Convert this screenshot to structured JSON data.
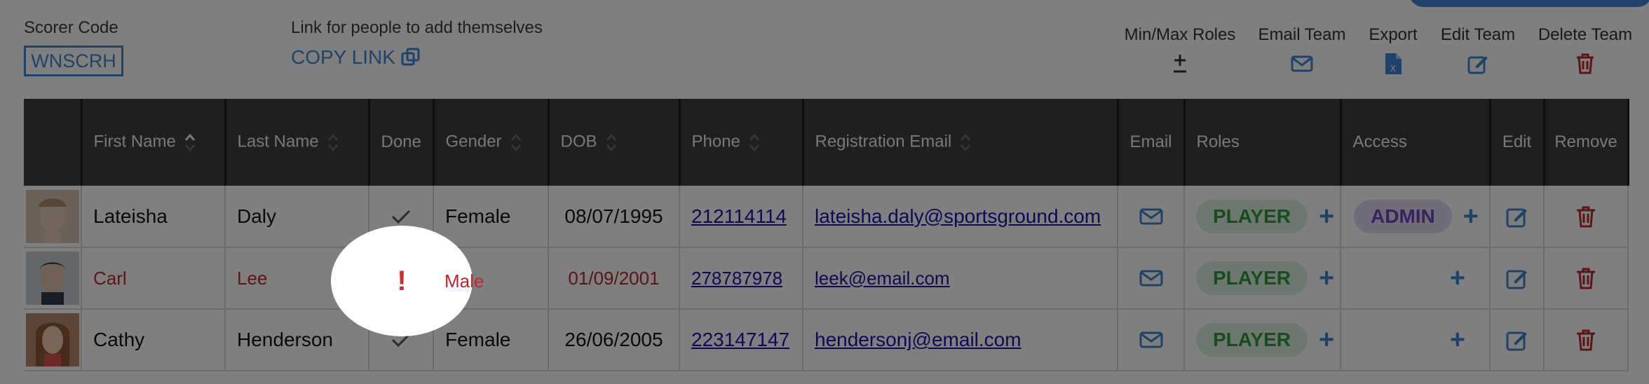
{
  "header": {
    "scorer_label": "Scorer Code",
    "scorer_code": "WNSCRH",
    "link_label": "Link for people to add themselves",
    "copy_link": "COPY LINK",
    "actions": [
      {
        "label": "Min/Max Roles",
        "icon": "plus-minus-icon"
      },
      {
        "label": "Email Team",
        "icon": "envelope-icon"
      },
      {
        "label": "Export",
        "icon": "excel-file-icon"
      },
      {
        "label": "Edit Team",
        "icon": "edit-icon"
      },
      {
        "label": "Delete Team",
        "icon": "trash-icon"
      }
    ]
  },
  "table": {
    "columns": [
      "",
      "First Name",
      "Last Name",
      "Done",
      "Gender",
      "DOB",
      "Phone",
      "Registration Email",
      "Email",
      "Roles",
      "Access",
      "Edit",
      "Remove"
    ],
    "rows": [
      {
        "first": "Lateisha",
        "last": "Daly",
        "done": "check",
        "gender": "Female",
        "dob": "08/07/1995",
        "phone": "212114114",
        "email": "lateisha.daly@sportsground.com",
        "role": "PLAYER",
        "access": "ADMIN"
      },
      {
        "first": "Carl",
        "last": "Lee",
        "done": "!",
        "gender": "Male",
        "dob": "01/09/2001",
        "phone": "278787978",
        "email": "leek@email.com",
        "role": "PLAYER",
        "access": ""
      },
      {
        "first": "Cathy",
        "last": "Henderson",
        "done": "check",
        "gender": "Female",
        "dob": "26/06/2005",
        "phone": "223147147",
        "email": "hendersonj@email.com",
        "role": "PLAYER",
        "access": ""
      }
    ]
  },
  "colors": {
    "accent": "#3c87d6",
    "warning": "#c0262c",
    "player_pill": "#d9efe0",
    "admin_pill": "#e2d8f5",
    "header_bg": "#3f3f3f"
  }
}
